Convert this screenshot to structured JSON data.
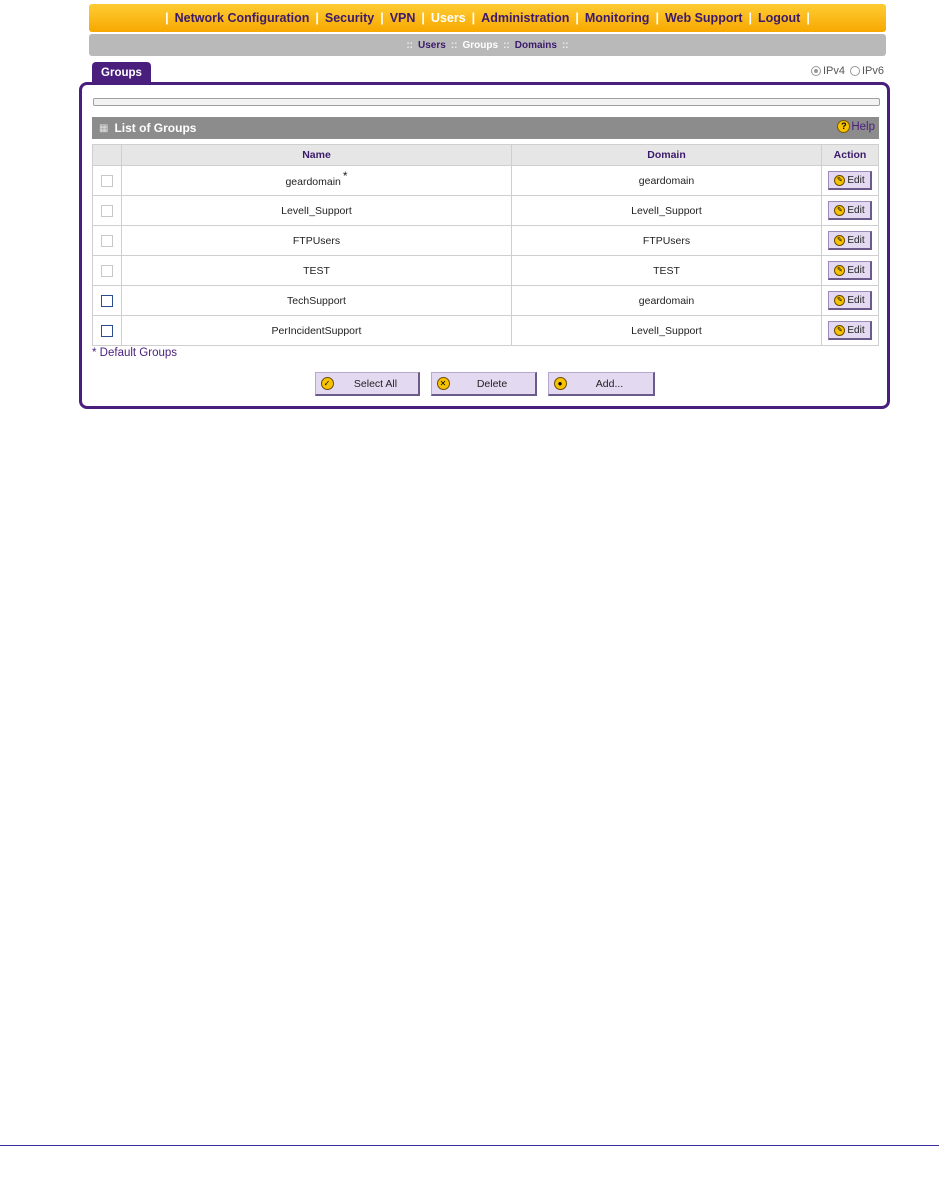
{
  "topnav": {
    "items": [
      {
        "label": "Network Configuration",
        "active": false
      },
      {
        "label": "Security",
        "active": false
      },
      {
        "label": "VPN",
        "active": false
      },
      {
        "label": "Users",
        "active": true
      },
      {
        "label": "Administration",
        "active": false
      },
      {
        "label": "Monitoring",
        "active": false
      },
      {
        "label": "Web Support",
        "active": false
      },
      {
        "label": "Logout",
        "active": false
      }
    ],
    "separator": "|"
  },
  "subnav": {
    "items": [
      {
        "label": "Users",
        "active": false
      },
      {
        "label": "Groups",
        "active": true
      },
      {
        "label": "Domains",
        "active": false
      }
    ],
    "separator": "::"
  },
  "tab": {
    "label": "Groups"
  },
  "ip_version": {
    "ipv4_label": "IPv4",
    "ipv6_label": "IPv6",
    "selected": "IPv4"
  },
  "list": {
    "title": "List of Groups",
    "help_label": "Help",
    "columns": {
      "name": "Name",
      "domain": "Domain",
      "action": "Action"
    },
    "edit_label": "Edit",
    "rows": [
      {
        "name": "geardomain",
        "domain": "geardomain",
        "is_default": true,
        "selectable": false
      },
      {
        "name": "LevelI_Support",
        "domain": "LevelI_Support",
        "is_default": false,
        "selectable": false
      },
      {
        "name": "FTPUsers",
        "domain": "FTPUsers",
        "is_default": false,
        "selectable": false
      },
      {
        "name": "TEST",
        "domain": "TEST",
        "is_default": false,
        "selectable": false
      },
      {
        "name": "TechSupport",
        "domain": "geardomain",
        "is_default": false,
        "selectable": true
      },
      {
        "name": "PerIncidentSupport",
        "domain": "LevelI_Support",
        "is_default": false,
        "selectable": true
      }
    ],
    "default_marker": "*",
    "default_note": "* Default Groups"
  },
  "buttons": {
    "select_all": "Select All",
    "delete": "Delete",
    "add": "Add..."
  },
  "colors": {
    "accent": "#4a1e7d",
    "nav_bg": "#f7a800",
    "subnav_bg": "#b9b9b9",
    "header_bg": "#8c8c8c"
  }
}
